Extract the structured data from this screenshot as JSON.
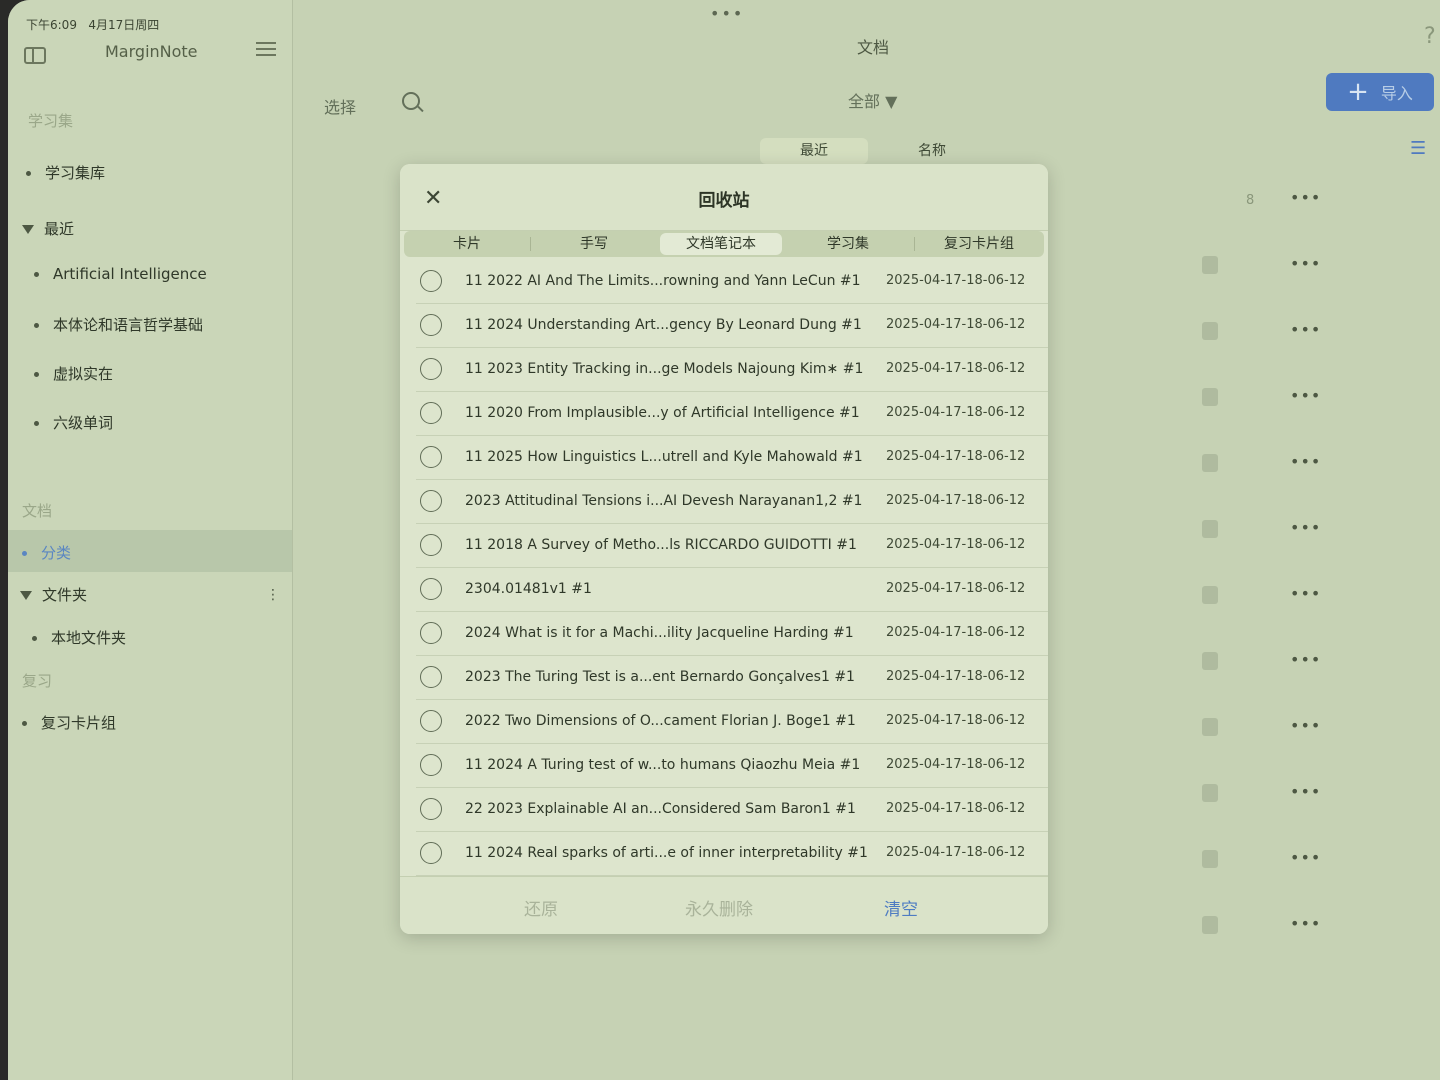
{
  "status": {
    "time": "下午6:09",
    "date": "4月17日周四"
  },
  "sidebar": {
    "app_title": "MarginNote",
    "study_sets_header": "学习集",
    "library": "学习集库",
    "recent_label": "最近",
    "recent_items": [
      "Artificial Intelligence",
      "本体论和语言哲学基础",
      "虚拟实在",
      "六级单词"
    ],
    "docs_header": "文档",
    "category": "分类",
    "folders": "文件夹",
    "local_folder": "本地文件夹",
    "review_header": "复习",
    "review_groups": "复习卡片组"
  },
  "main": {
    "title": "文档",
    "select": "选择",
    "filter": "全部 ▼",
    "import": "导入",
    "sort_recent": "最近",
    "sort_name": "名称",
    "first_row_count": "8"
  },
  "dialog": {
    "title": "回收站",
    "tabs": [
      "卡片",
      "手写",
      "文档笔记本",
      "学习集",
      "复习卡片组"
    ],
    "active_tab": "文档笔记本",
    "items": [
      {
        "name": "11 2022 AI And The Limits...rowning and Yann LeCun #1",
        "date": "2025-04-17-18-06-12"
      },
      {
        "name": "11 2024 Understanding Art...gency By Leonard Dung #1",
        "date": "2025-04-17-18-06-12"
      },
      {
        "name": "11 2023 Entity Tracking in...ge Models Najoung Kim∗ #1",
        "date": "2025-04-17-18-06-12"
      },
      {
        "name": "11 2020 From Implausible...y of Artificial Intelligence #1",
        "date": "2025-04-17-18-06-12"
      },
      {
        "name": "11 2025 How Linguistics L...utrell and Kyle Mahowald #1",
        "date": "2025-04-17-18-06-12"
      },
      {
        "name": "2023 Attitudinal Tensions i...AI Devesh Narayanan1,2 #1",
        "date": "2025-04-17-18-06-12"
      },
      {
        "name": "11 2018 A Survey of Metho...ls RICCARDO GUIDOTTI #1",
        "date": "2025-04-17-18-06-12"
      },
      {
        "name": "2304.01481v1 #1",
        "date": "2025-04-17-18-06-12"
      },
      {
        "name": "2024 What is it for a Machi...ility Jacqueline Harding #1",
        "date": "2025-04-17-18-06-12"
      },
      {
        "name": "2023 The Turing Test is a...ent Bernardo Gonçalves1 #1",
        "date": "2025-04-17-18-06-12"
      },
      {
        "name": "2022 Two Dimensions of O...cament Florian J. Boge1 #1",
        "date": "2025-04-17-18-06-12"
      },
      {
        "name": "11 2024 A Turing test of w...to humans Qiaozhu Meia #1",
        "date": "2025-04-17-18-06-12"
      },
      {
        "name": "22 2023 Explainable AI an...Considered Sam Baron1 #1",
        "date": "2025-04-17-18-06-12"
      },
      {
        "name": "11 2024 Real sparks of arti...e of inner interpretability #1",
        "date": "2025-04-17-18-06-12"
      }
    ],
    "restore": "还原",
    "delete_forever": "永久删除",
    "empty": "清空"
  }
}
